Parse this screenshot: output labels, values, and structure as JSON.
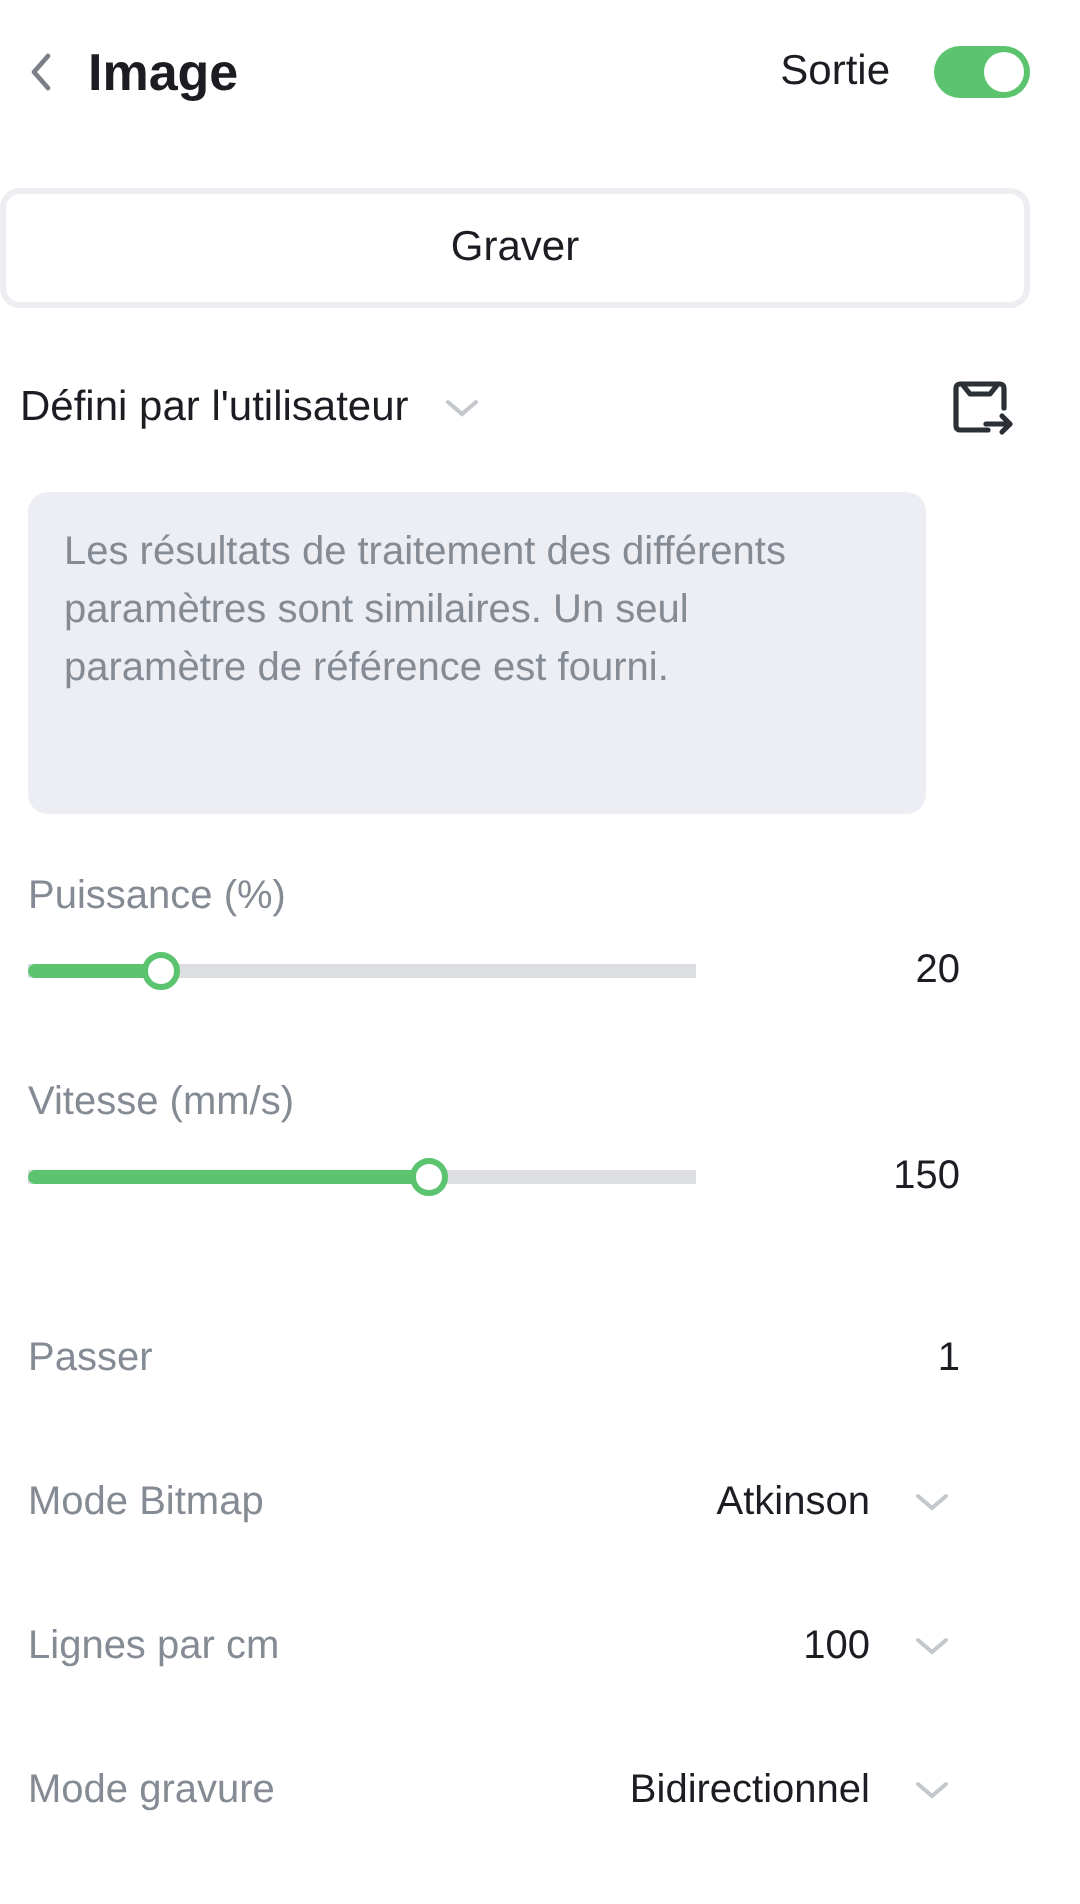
{
  "header": {
    "title": "Image",
    "output_label": "Sortie",
    "output_on": true
  },
  "mode_button": "Graver",
  "preset": {
    "value": "Défini par l'utilisateur"
  },
  "note": "Les résultats de traitement des différents paramètres sont similaires. Un seul paramètre de référence est fourni.",
  "sliders": [
    {
      "label": "Puissance (%)",
      "level": 0.2,
      "reading": "20"
    },
    {
      "label": "Vitesse (mm/s)",
      "level": 0.6,
      "reading": "150"
    }
  ],
  "settings": [
    {
      "kind": "number",
      "label": "Passer",
      "value": "1"
    },
    {
      "kind": "select",
      "label": "Mode Bitmap",
      "value": "Atkinson"
    },
    {
      "kind": "select",
      "label": "Lignes par cm",
      "value": "100"
    },
    {
      "kind": "select",
      "label": "Mode gravure",
      "value": "Bidirectionnel"
    }
  ]
}
